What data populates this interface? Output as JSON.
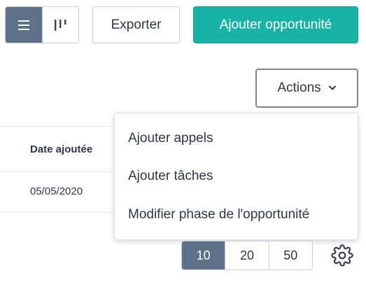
{
  "toolbar": {
    "view_toggle": {
      "list_icon": "list-icon",
      "columns_icon": "columns-icon",
      "active": "list"
    },
    "export_label": "Exporter",
    "add_label": "Ajouter opportunité",
    "actions_label": "Actions",
    "actions_icon": "chevron-down-icon"
  },
  "table": {
    "column_header": "Date ajoutée",
    "rows": [
      {
        "date": "05/05/2020"
      }
    ]
  },
  "actions_menu": {
    "items": [
      {
        "label": "Ajouter appels"
      },
      {
        "label": "Ajouter tâches"
      },
      {
        "label": "Modifier phase de l'opportunité"
      }
    ]
  },
  "pagination": {
    "options": [
      "10",
      "20",
      "50"
    ],
    "selected": "10",
    "settings_icon": "gear-icon"
  },
  "colors": {
    "accent": "#17b3a7",
    "active_toggle": "#5f7189",
    "border": "#c9ced6",
    "text": "#2d3748"
  }
}
